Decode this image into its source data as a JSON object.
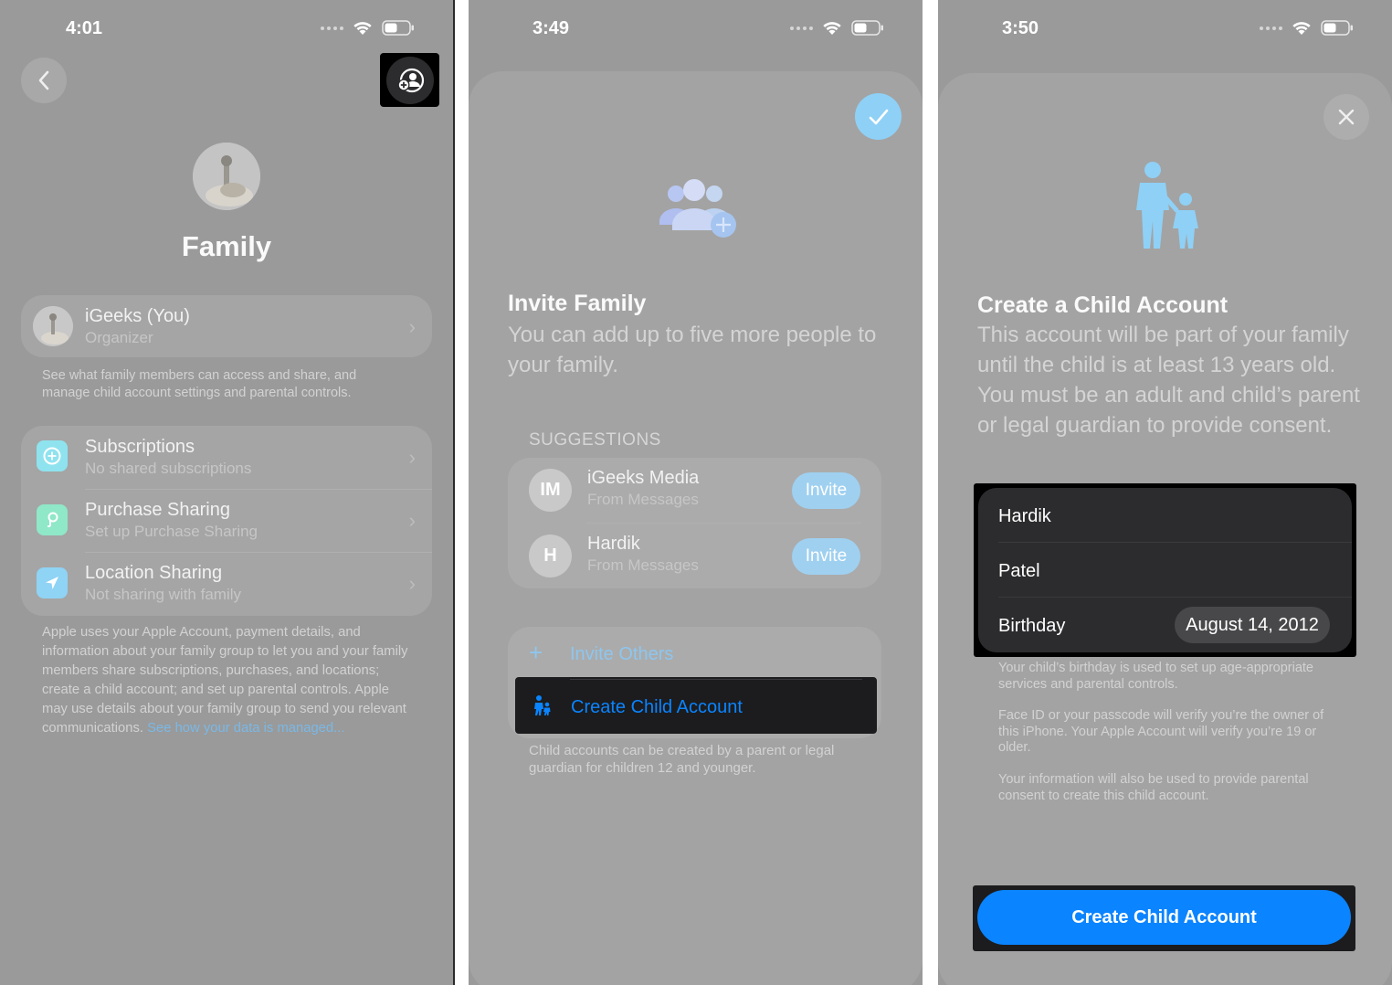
{
  "screen1": {
    "time": "4:01",
    "title": "Family",
    "member": {
      "name": "iGeeks (You)",
      "role": "Organizer"
    },
    "member_note": "See what family members can access and share, and manage child account settings and parental controls.",
    "rows": [
      {
        "title": "Subscriptions",
        "subtitle": "No shared subscriptions",
        "icon": "subscriptions-icon",
        "color": "#8fe3ef"
      },
      {
        "title": "Purchase Sharing",
        "subtitle": "Set up Purchase Sharing",
        "icon": "purchase-sharing-icon",
        "color": "#8fe8c8"
      },
      {
        "title": "Location Sharing",
        "subtitle": "Not sharing with family",
        "icon": "location-icon",
        "color": "#8fd3f5"
      }
    ],
    "footer_text": "Apple uses your Apple Account, payment details, and information about your family group to let you and your family members share subscriptions, purchases, and locations; create a child account; and set up parental controls. Apple may use details about your family group to send you relevant communications. ",
    "footer_link": "See how your data is managed..."
  },
  "screen2": {
    "time": "3:49",
    "title": "Invite Family",
    "subtitle": "You can add up to five more people to your family.",
    "suggestions_header": "SUGGESTIONS",
    "suggestions": [
      {
        "initials": "IM",
        "name": "iGeeks Media",
        "source": "From Messages",
        "action": "Invite"
      },
      {
        "initials": "H",
        "name": "Hardik",
        "source": "From Messages",
        "action": "Invite"
      }
    ],
    "invite_others": "Invite Others",
    "create_child": "Create Child Account",
    "child_note": "Child accounts can be created by a parent or legal guardian for children 12 and younger."
  },
  "screen3": {
    "time": "3:50",
    "title": "Create a Child Account",
    "description": "This account will be part of your family until the child is at least 13 years old. You must be an adult and child’s parent or legal guardian to provide consent.",
    "first_name": "Hardik",
    "last_name": "Patel",
    "birthday_label": "Birthday",
    "birthday_value": "August 14, 2012",
    "note1": "Your child’s birthday is used to set up age-appropriate services and parental controls.",
    "note2": "Face ID or your passcode will verify you’re the owner of this iPhone. Your Apple Account will verify you’re 19 or older.",
    "note3": "Your information will also be used to provide parental consent to create this child account.",
    "button": "Create Child Account"
  },
  "colors": {
    "accent_blue": "#0a84ff",
    "link_blue": "#7ab8e6",
    "highlight_box": "#1c1c1e"
  }
}
